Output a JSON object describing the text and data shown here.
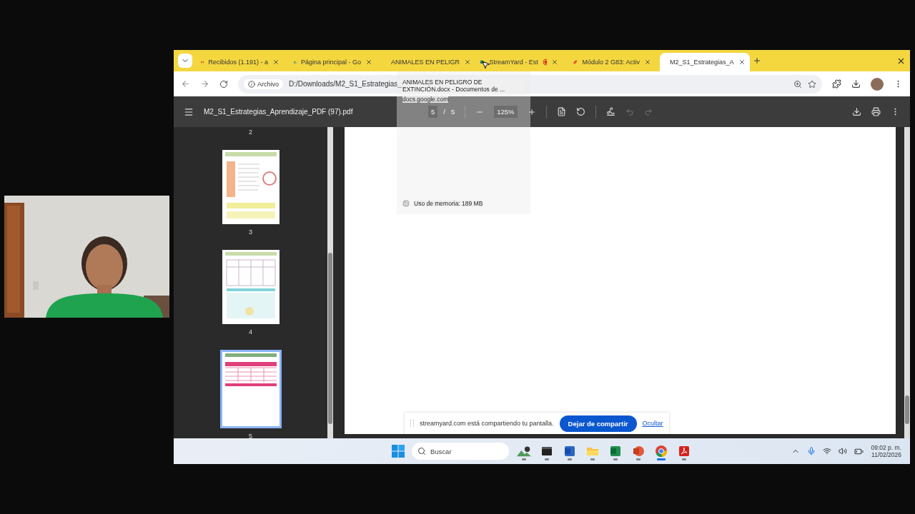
{
  "browser": {
    "tabs": [
      {
        "title": "Recibidos (1.191) - a",
        "kind": "mail",
        "selected": false
      },
      {
        "title": "Página principal - Go",
        "kind": "drive",
        "selected": false
      },
      {
        "title": "ANIMALES EN PELIGR",
        "kind": "docs",
        "selected": false
      },
      {
        "title": "StreamYard - Est",
        "kind": "stream",
        "selected": false,
        "recording": true
      },
      {
        "title": "Módulo 2 G83: Activ",
        "kind": "module",
        "selected": false
      },
      {
        "title": "M2_S1_Estrategias_A",
        "kind": "web",
        "selected": true
      }
    ],
    "address": {
      "badge": "Archivo",
      "url": "D:/Downloads/M2_S1_Estrategias_"
    },
    "hover_card": {
      "title": "ANIMALES EN PELIGRO DE EXTINCIÓN.docx - Documentos de ...",
      "domain": "docs.google.com",
      "memory": "Uso de memoria: 189 MB"
    }
  },
  "pdf_viewer": {
    "file": "M2_S1_Estrategias_Aprendizaje_PDF (97).pdf",
    "page": "5",
    "separator": "/",
    "total": "5",
    "zoom": "125%",
    "top_page_label": "2",
    "thumbnails": [
      {
        "label": "3",
        "kind": "alarm",
        "selected": false
      },
      {
        "label": "4",
        "kind": "table",
        "selected": false
      },
      {
        "label": "5",
        "kind": "form",
        "selected": true
      }
    ]
  },
  "share_bar": {
    "message": "streamyard.com está compartiendo tu pantalla.",
    "stop": "Dejar de compartir",
    "hide": "Ocultar"
  },
  "taskbar": {
    "search": "Buscar",
    "apps": [
      {
        "kind": "widget",
        "active": false
      },
      {
        "kind": "terminal",
        "active": false
      },
      {
        "kind": "word",
        "active": false
      },
      {
        "kind": "files",
        "active": false
      },
      {
        "kind": "excel",
        "active": false
      },
      {
        "kind": "powerpoint",
        "active": false
      },
      {
        "kind": "chrome",
        "active": true
      },
      {
        "kind": "acrobat",
        "active": false
      }
    ],
    "time": "09:02 p. m.",
    "date": "11/02/2026"
  }
}
